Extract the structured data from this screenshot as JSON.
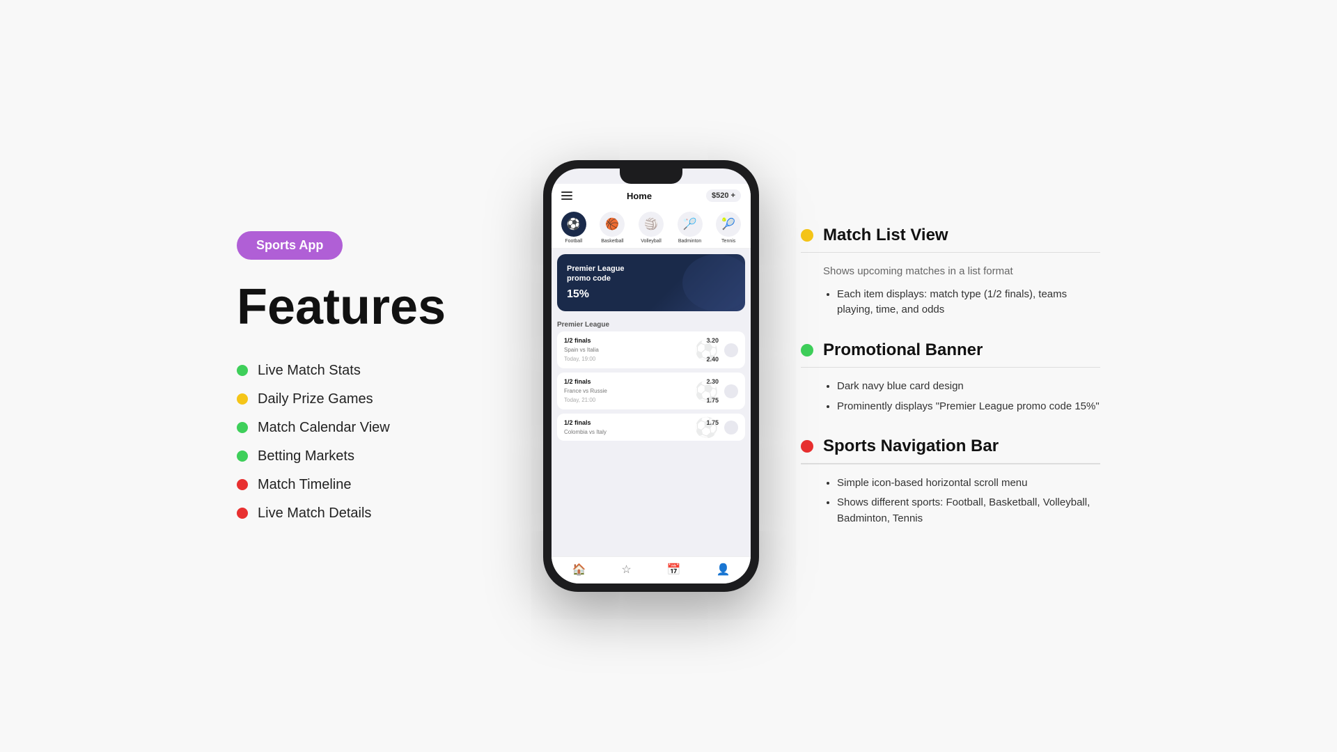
{
  "badge": {
    "label": "Sports App"
  },
  "left": {
    "title": "Features",
    "features": [
      {
        "label": "Live Match Stats",
        "dot": "green"
      },
      {
        "label": "Daily Prize Games",
        "dot": "yellow"
      },
      {
        "label": "Match Calendar View",
        "dot": "green"
      },
      {
        "label": "Betting Markets",
        "dot": "green"
      },
      {
        "label": "Match Timeline",
        "dot": "red"
      },
      {
        "label": "Live Match Details",
        "dot": "red"
      }
    ]
  },
  "phone": {
    "header": {
      "title": "Home",
      "balance": "$520 +"
    },
    "sports": [
      {
        "label": "Football",
        "active": true,
        "icon": "⚽"
      },
      {
        "label": "Basketball",
        "active": false,
        "icon": "🏀"
      },
      {
        "label": "Volleyball",
        "active": false,
        "icon": "🏐"
      },
      {
        "label": "Badminton",
        "active": false,
        "icon": "🏸"
      },
      {
        "label": "Tennis",
        "active": false,
        "icon": "🎾"
      }
    ],
    "promo": {
      "title": "Premier League\npromo code",
      "code": "15%"
    },
    "league": "Premier League",
    "matches": [
      {
        "type": "1/2 finals",
        "teams": "Spain vs Italia",
        "time": "Today, 19:00",
        "odds": "3.20"
      },
      {
        "type": "1/2 finals",
        "teams": "Spain vs Italia",
        "time": "Today, 19:00",
        "odds": "2.40"
      },
      {
        "type": "1/2 finals",
        "teams": "France vs Russie",
        "time": "Today, 21:00",
        "odds": "2.30"
      },
      {
        "type": "1/2 finals",
        "teams": "France vs Russie",
        "time": "Today, 21:00",
        "odds": "1.75"
      },
      {
        "type": "1/2 finals",
        "teams": "Colombia vs Italy",
        "time": "",
        "odds": "1.75"
      }
    ]
  },
  "right": {
    "sections": [
      {
        "dot": "yellow",
        "title": "Match List View",
        "divider": true,
        "intro": "Shows upcoming matches in a list format",
        "bullets": [
          "Each item displays: match type (1/2 finals), teams playing, time, and odds"
        ]
      },
      {
        "dot": "green",
        "title": "Promotional Banner",
        "divider": true,
        "intro": null,
        "bullets": [
          "Dark navy blue card design",
          "Prominently displays \"Premier League promo code 15%\""
        ]
      },
      {
        "dot": "red",
        "title": "Sports Navigation Bar",
        "divider": true,
        "intro": null,
        "bullets": [
          "Simple icon-based horizontal scroll menu",
          "Shows different sports: Football, Basketball, Volleyball, Badminton, Tennis"
        ]
      }
    ]
  }
}
